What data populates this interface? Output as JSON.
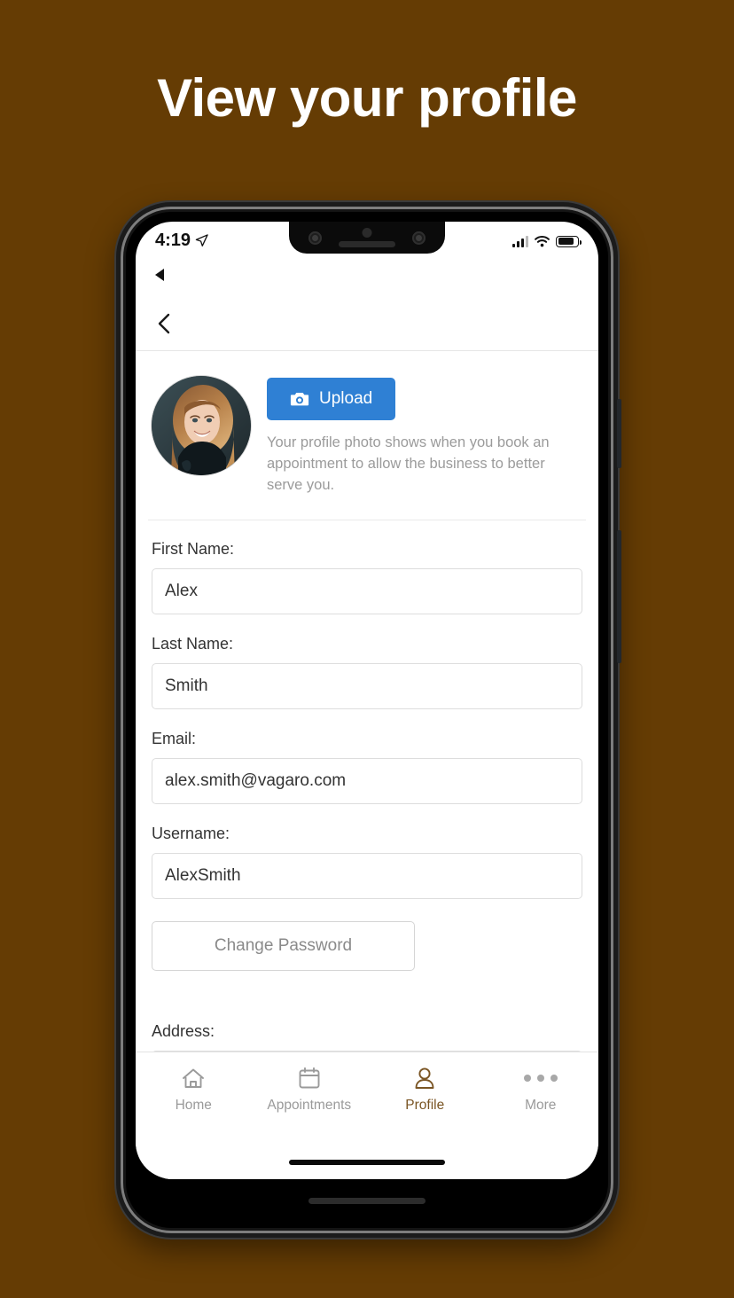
{
  "headline": "View your profile",
  "theme": {
    "background": "#653c04",
    "accent": "#7a5524",
    "primary_button": "#2f80d4"
  },
  "status_bar": {
    "time": "4:19",
    "location_icon": "location-arrow-icon",
    "signal_icon": "cellular-signal-icon",
    "wifi_icon": "wifi-icon",
    "battery_icon": "battery-icon"
  },
  "nav": {
    "back_icon": "chevron-left-icon",
    "mini_back_icon": "triangle-left-icon"
  },
  "photo_section": {
    "avatar_alt": "profile-photo",
    "upload_label": "Upload",
    "upload_icon": "camera-icon",
    "note": "Your profile photo shows when you book an appointment to allow the business to better serve you."
  },
  "form": {
    "fields": [
      {
        "label": "First Name:",
        "value": "Alex",
        "name": "first-name"
      },
      {
        "label": "Last Name:",
        "value": "Smith",
        "name": "last-name"
      },
      {
        "label": "Email:",
        "value": "alex.smith@vagaro.com",
        "name": "email"
      },
      {
        "label": "Username:",
        "value": "AlexSmith",
        "name": "username"
      }
    ],
    "change_password_label": "Change Password",
    "address_label": "Address:"
  },
  "tabbar": {
    "items": [
      {
        "label": "Home",
        "icon": "home-icon",
        "active": false
      },
      {
        "label": "Appointments",
        "icon": "calendar-icon",
        "active": false
      },
      {
        "label": "Profile",
        "icon": "person-icon",
        "active": true
      },
      {
        "label": "More",
        "icon": "ellipsis-icon",
        "active": false
      }
    ]
  }
}
